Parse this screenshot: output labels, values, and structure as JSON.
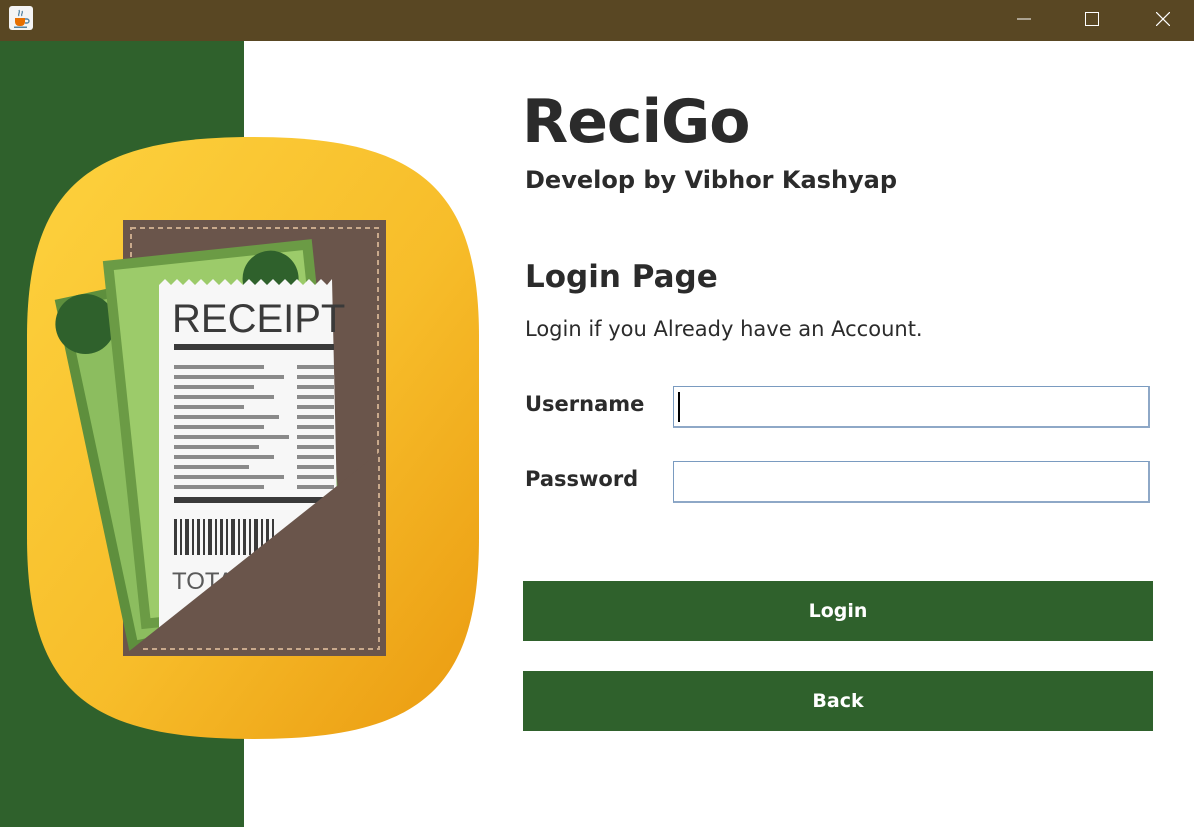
{
  "window": {
    "app_icon": "java-cup-icon",
    "controls": {
      "minimize": "minimize-icon",
      "maximize": "maximize-icon",
      "close": "close-icon"
    },
    "titlebar_color": "#594723"
  },
  "branding": {
    "app_name": "ReciGo",
    "developer_line": "Develop by Vibhor Kashyap",
    "logo_text": "RECEIPT",
    "logo_footer_text": "TOTA",
    "logo_icon": "receipt-wallet-icon"
  },
  "login": {
    "page_title": "Login Page",
    "description": "Login if you Already have an Account.",
    "username_label": "Username",
    "username_value": "",
    "password_label": "Password",
    "password_value": "",
    "login_button": "Login",
    "back_button": "Back"
  },
  "colors": {
    "accent_green": "#2f612c",
    "logo_yellow": "#f7be2b",
    "text_dark": "#2b2b2b"
  }
}
